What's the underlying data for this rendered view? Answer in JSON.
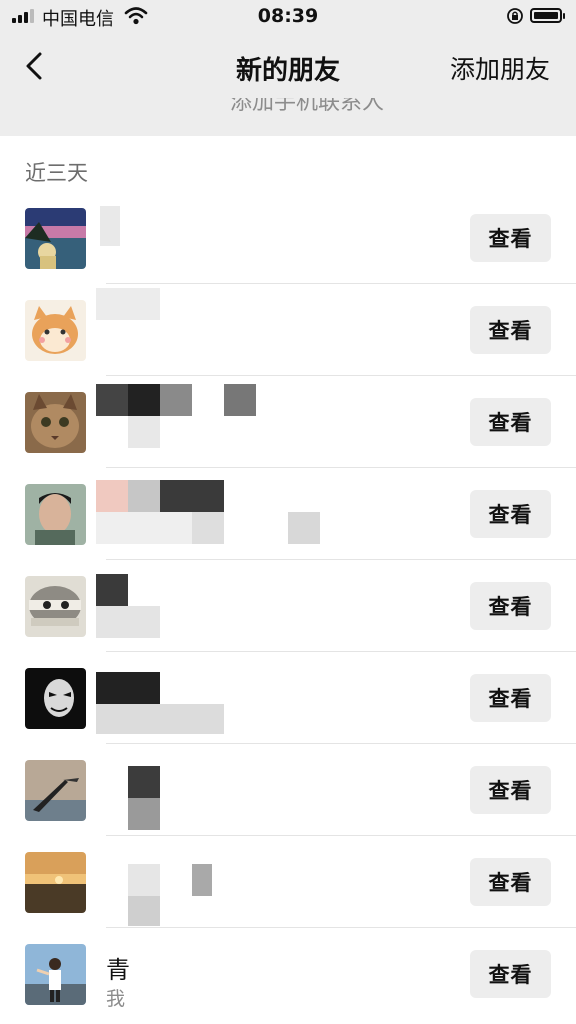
{
  "status_bar": {
    "carrier": "中国电信",
    "time": "08:39",
    "icons": [
      "signal-icon",
      "wifi-icon",
      "orientation-lock-icon",
      "battery-icon"
    ]
  },
  "nav": {
    "back_icon": "chevron-left-icon",
    "title": "新的朋友",
    "add_friend": "添加朋友"
  },
  "phone_contacts": {
    "label": "添加手机联系人"
  },
  "section": {
    "title": "近三天"
  },
  "rows": [
    {
      "name": "",
      "message": "",
      "button": "查看"
    },
    {
      "name": "",
      "message": "",
      "button": "查看"
    },
    {
      "name": "",
      "message": "",
      "button": "查看"
    },
    {
      "name": "",
      "message": "",
      "button": "查看"
    },
    {
      "name": "",
      "message": "",
      "button": "查看"
    },
    {
      "name": "",
      "message": "",
      "button": "查看"
    },
    {
      "name": "",
      "message": "",
      "button": "查看"
    },
    {
      "name": "",
      "message": "",
      "button": "查看"
    },
    {
      "name": "青",
      "message": "我",
      "button": "查看"
    }
  ],
  "colors": {
    "header_bg": "#ededed",
    "button_bg": "#ededed",
    "secondary_text": "#8c8c8c"
  }
}
